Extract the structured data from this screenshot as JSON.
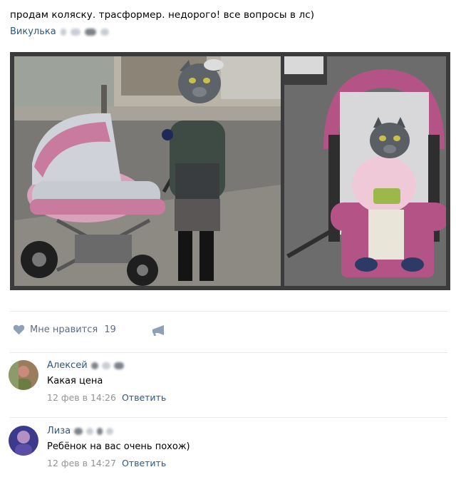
{
  "post": {
    "text": "продам коляску. трасформер. недорого! все вопросы в лс)",
    "author": "Викулька"
  },
  "photos": {
    "left_alt": "Cat-headed woman with pink stroller",
    "right_alt": "Cat-headed baby sitting in pink stroller"
  },
  "actions": {
    "like_label": "Мне нравится",
    "like_count": "19",
    "like_icon": "heart-icon",
    "share_icon": "megaphone-icon"
  },
  "comments": [
    {
      "name": "Алексей",
      "text": "Какая цена",
      "date": "12 фев в 14:26",
      "reply": "Ответить"
    },
    {
      "name": "Лиза",
      "text": "Ребёнок на вас очень похож)",
      "date": "12 фев в 14:27",
      "reply": "Ответить"
    }
  ],
  "colors": {
    "link": "#2a5885",
    "muted": "#939393",
    "stroller_pink": "#c97a9f"
  }
}
